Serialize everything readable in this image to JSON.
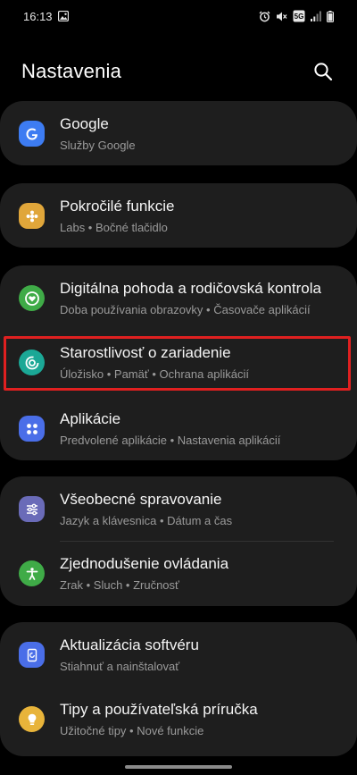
{
  "status_bar": {
    "time": "16:13",
    "icons": [
      "gallery-icon",
      "alarm-icon",
      "mute-icon",
      "5g-icon",
      "signal-icon",
      "battery-icon"
    ],
    "network_label": "5G"
  },
  "header": {
    "title": "Nastavenia",
    "search_icon": "search-icon"
  },
  "items": [
    {
      "id": "google",
      "title": "Google",
      "subtitle": "Služby Google",
      "icon": "google-icon",
      "color": "#3d7cf2"
    },
    {
      "id": "advanced",
      "title": "Pokročilé funkcie",
      "subtitle": "Labs  •  Bočné tlačidlo",
      "icon": "puzzle-icon",
      "color": "#e0a63a"
    },
    {
      "id": "wellbeing",
      "title": "Digitálna pohoda a rodičovská kontrola",
      "subtitle": "Doba používania obrazovky  •  Časovače aplikácií",
      "icon": "heart-circle-icon",
      "color": "#3fab47"
    },
    {
      "id": "device-care",
      "title": "Starostlivosť o zariadenie",
      "subtitle": "Úložisko  •  Pamäť  •  Ochrana aplikácií",
      "icon": "device-care-icon",
      "color": "#1ba896"
    },
    {
      "id": "apps",
      "title": "Aplikácie",
      "subtitle": "Predvolené aplikácie  •  Nastavenia aplikácií",
      "icon": "apps-grid-icon",
      "color": "#4a6ee8"
    },
    {
      "id": "general",
      "title": "Všeobecné spravovanie",
      "subtitle": "Jazyk a klávesnica  •  Dátum a čas",
      "icon": "sliders-icon",
      "color": "#6a6bb8"
    },
    {
      "id": "accessibility",
      "title": "Zjednodušenie ovládania",
      "subtitle": "Zrak  •  Sluch  •  Zručnosť",
      "icon": "accessibility-icon",
      "color": "#3fab47"
    },
    {
      "id": "update",
      "title": "Aktualizácia softvéru",
      "subtitle": "Stiahnuť a nainštalovať",
      "icon": "update-icon",
      "color": "#4a6ee8"
    },
    {
      "id": "tips",
      "title": "Tipy a používateľská príručka",
      "subtitle": "Užitočné tipy  •  Nové funkcie",
      "icon": "lightbulb-icon",
      "color": "#e8b43a"
    }
  ],
  "highlight_color": "#e02020"
}
